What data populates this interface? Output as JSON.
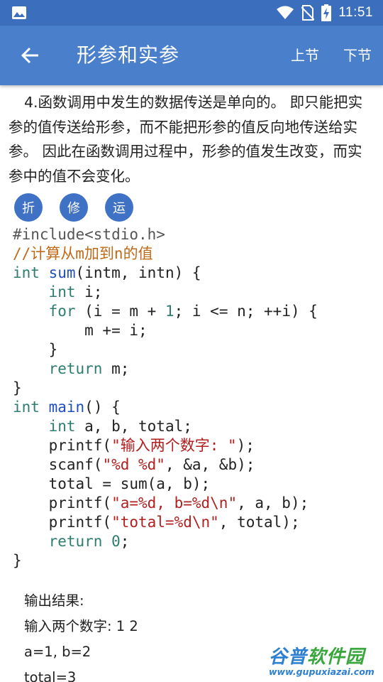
{
  "status_bar": {
    "time": "11:51",
    "icons": [
      "image-icon",
      "wifi-icon",
      "no-sim-icon",
      "battery-charging-icon"
    ]
  },
  "app_bar": {
    "title": "形参和实参",
    "prev_label": "上节",
    "next_label": "下节"
  },
  "description": "4.函数调用中发生的数据传送是单向的。 即只能把实参的值传送给形参，而不能把形参的值反向地传送给实参。 因此在函数调用过程中，形参的值发生改变，而实参中的值不会变化。",
  "tool_buttons": [
    "折",
    "修",
    "运"
  ],
  "code_lines": [
    [
      {
        "t": "#include<stdio.h>",
        "c": "pp"
      }
    ],
    [
      {
        "t": "//计算从m加到n的值",
        "c": "cm"
      }
    ],
    [
      {
        "t": "int",
        "c": "kw"
      },
      {
        "t": " "
      },
      {
        "t": "sum",
        "c": "fn"
      },
      {
        "t": "(intm, intn) {"
      }
    ],
    [
      {
        "t": "    "
      },
      {
        "t": "int",
        "c": "kw"
      },
      {
        "t": " i;"
      }
    ],
    [
      {
        "t": "    "
      },
      {
        "t": "for",
        "c": "kw"
      },
      {
        "t": " (i = m + "
      },
      {
        "t": "1",
        "c": "num"
      },
      {
        "t": "; i <= n; ++i) {"
      }
    ],
    [
      {
        "t": "        m += i;"
      }
    ],
    [
      {
        "t": "    }"
      }
    ],
    [
      {
        "t": "    "
      },
      {
        "t": "return",
        "c": "kw"
      },
      {
        "t": " m;"
      }
    ],
    [
      {
        "t": "}"
      }
    ],
    [
      {
        "t": "int",
        "c": "kw"
      },
      {
        "t": " "
      },
      {
        "t": "main",
        "c": "fn"
      },
      {
        "t": "() {"
      }
    ],
    [
      {
        "t": "    "
      },
      {
        "t": "int",
        "c": "kw"
      },
      {
        "t": " a, b, total;"
      }
    ],
    [
      {
        "t": "    printf("
      },
      {
        "t": "\"输入两个数字: \"",
        "c": "str"
      },
      {
        "t": ");"
      }
    ],
    [
      {
        "t": "    scanf("
      },
      {
        "t": "\"%d %d\"",
        "c": "str"
      },
      {
        "t": ", &a, &b);"
      }
    ],
    [
      {
        "t": "    total = sum(a, b);"
      }
    ],
    [
      {
        "t": "    printf("
      },
      {
        "t": "\"a=%d, b=%d\\n\"",
        "c": "str"
      },
      {
        "t": ", a, b);"
      }
    ],
    [
      {
        "t": "    printf("
      },
      {
        "t": "\"total=%d\\n\"",
        "c": "str"
      },
      {
        "t": ", total);"
      }
    ],
    [
      {
        "t": "    "
      },
      {
        "t": "return",
        "c": "kw"
      },
      {
        "t": " "
      },
      {
        "t": "0",
        "c": "num"
      },
      {
        "t": ";"
      }
    ],
    [
      {
        "t": "}"
      }
    ]
  ],
  "output": {
    "heading": "输出结果:",
    "lines": [
      "输入两个数字: 1 2",
      "a=1, b=2",
      "total=3"
    ]
  },
  "watermark": {
    "logo_a": "谷普",
    "logo_b": "软件园",
    "url": "www.gupuxiazai.com"
  },
  "colors": {
    "status_bar": "#3b6fbd",
    "app_bar": "#4a7fcb",
    "button": "#3f72c4",
    "keyword": "#2e7d70",
    "function": "#1f4fbf",
    "string": "#b11f1f",
    "comment": "#c06a18"
  }
}
